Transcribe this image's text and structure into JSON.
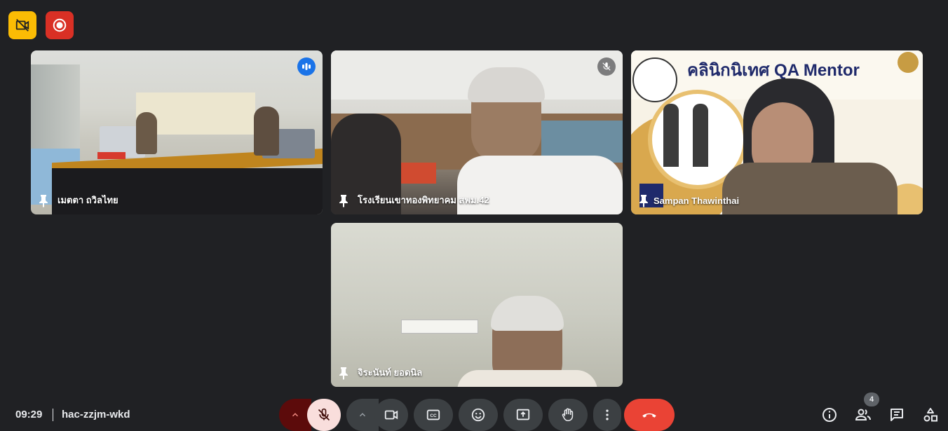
{
  "meeting": {
    "time": "09:29",
    "code": "hac-zzjm-wkd"
  },
  "top_badges": [
    {
      "icon": "no-video-icon",
      "color": "#fbbc04"
    },
    {
      "icon": "record-icon",
      "color": "#d93025"
    }
  ],
  "tiles": [
    {
      "name": "เมตตา ถวิลไทย",
      "status": "speaking"
    },
    {
      "name": "โรงเรียนเขาทองพิทยาคม สพม.42",
      "status": "muted"
    },
    {
      "name": "Sampan Thawinthai",
      "banner_title": "QA Mentor",
      "banner_title_th": "คลินิกนิเทศ"
    },
    {
      "name": "จิระนันท์ ยอดนิล"
    }
  ],
  "controls": {
    "mic_state": "muted",
    "participants_count": "4",
    "end_call_color": "#ea4335"
  }
}
